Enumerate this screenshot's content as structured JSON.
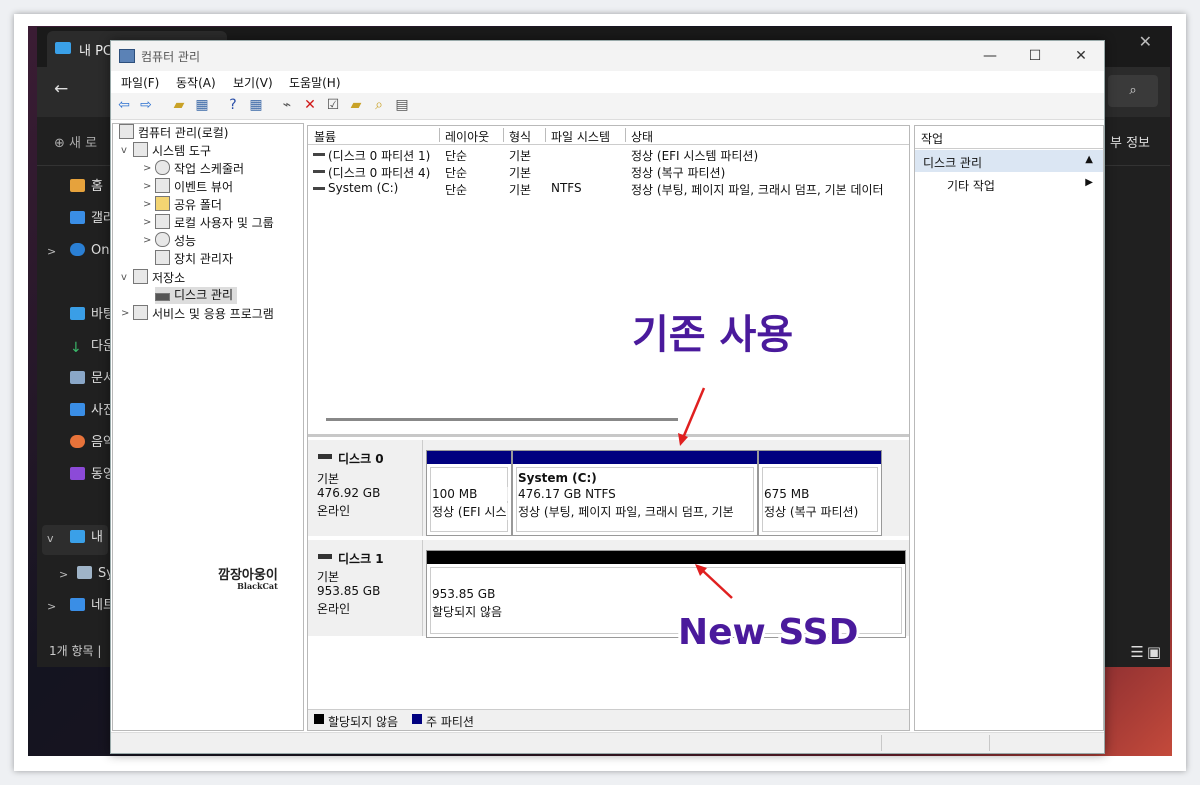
{
  "explorer": {
    "tab_label": "내 PC",
    "close_glyph": "✕",
    "back_glyph": "←",
    "new_label": "새 로",
    "details_label": "부 정보",
    "status": "1개 항목 |",
    "nav_items": [
      "홈",
      "갤러",
      "One",
      "바탕",
      "다운",
      "문서",
      "사진",
      "음악",
      "동영",
      "내",
      "Sy",
      "네트"
    ]
  },
  "window": {
    "title": "컴퓨터 관리",
    "minimize_glyph": "—",
    "maximize_glyph": "☐",
    "close_glyph": "✕"
  },
  "menu": [
    "파일(F)",
    "동작(A)",
    "보기(V)",
    "도움말(H)"
  ],
  "tree": {
    "root": "컴퓨터 관리(로컬)",
    "system_tools": "시스템 도구",
    "task_scheduler": "작업 스케줄러",
    "event_viewer": "이벤트 뷰어",
    "shared_folders": "공유 폴더",
    "local_users": "로컬 사용자 및 그룹",
    "performance": "성능",
    "device_manager": "장치 관리자",
    "storage": "저장소",
    "disk_management": "디스크 관리",
    "services": "서비스 및 응용 프로그램"
  },
  "volume_list": {
    "columns": [
      "볼륨",
      "레이아웃",
      "형식",
      "파일 시스템",
      "상태"
    ],
    "rows": [
      {
        "volume": "(디스크 0 파티션 1)",
        "layout": "단순",
        "type": "기본",
        "fs": "",
        "status": "정상 (EFI 시스템 파티션)"
      },
      {
        "volume": "(디스크 0 파티션 4)",
        "layout": "단순",
        "type": "기본",
        "fs": "",
        "status": "정상 (복구 파티션)"
      },
      {
        "volume": "System (C:)",
        "layout": "단순",
        "type": "기본",
        "fs": "NTFS",
        "status": "정상 (부팅, 페이지 파일, 크래시 덤프, 기본 데이터"
      }
    ]
  },
  "disks": [
    {
      "name": "디스크 0",
      "kind": "기본",
      "size": "476.92 GB",
      "state": "온라인",
      "partitions": [
        {
          "line1": "",
          "line2": "100 MB",
          "line3": "정상 (EFI 시스"
        },
        {
          "line1": "System  (C:)",
          "line2": "476.17 GB NTFS",
          "line3": "정상 (부팅, 페이지 파일, 크래시 덤프, 기본"
        },
        {
          "line1": "",
          "line2": "675 MB",
          "line3": "정상 (복구 파티션)"
        }
      ]
    },
    {
      "name": "디스크 1",
      "kind": "기본",
      "size": "953.85 GB",
      "state": "온라인",
      "partitions": [
        {
          "line1": "953.85 GB",
          "line2": "할당되지 않음"
        }
      ]
    }
  ],
  "legend": {
    "unallocated": "할당되지 않음",
    "primary": "주 파티션"
  },
  "actions": {
    "header": "작업",
    "section": "디스크 관리",
    "item": "기타 작업",
    "section_arrow": "▲",
    "item_arrow": "▶"
  },
  "annotations": {
    "existing": "기존 사용",
    "new_ssd": "New SSD"
  },
  "watermark": {
    "main": "깜장아웅이",
    "sub": "BlackCat"
  },
  "colors": {
    "primary_partition": "#00007f",
    "unallocated": "#000000",
    "annotation": "#4a1a9c",
    "arrow": "#e02020"
  }
}
